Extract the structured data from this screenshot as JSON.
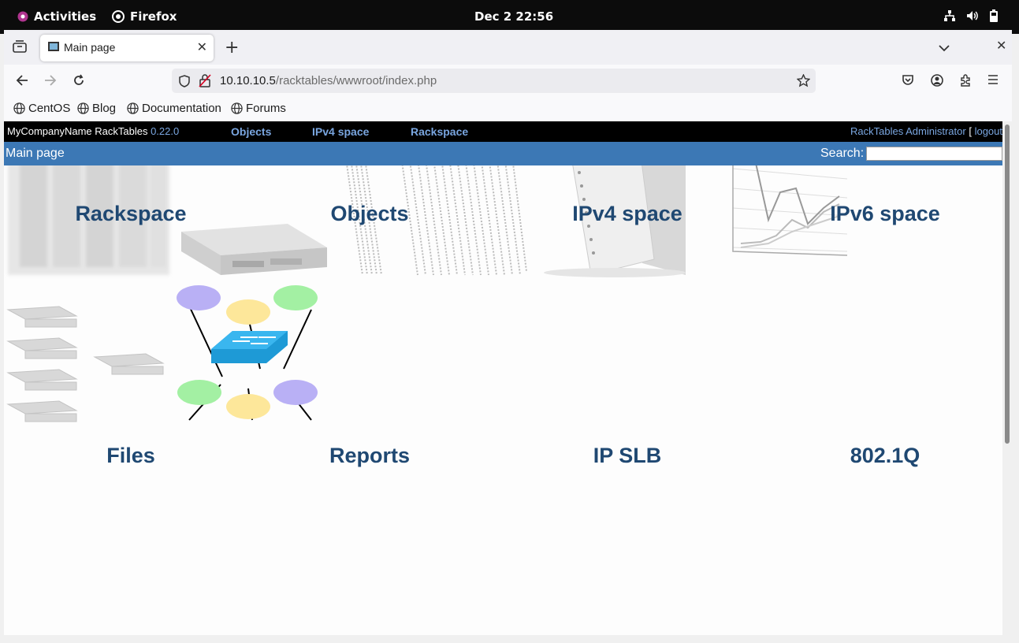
{
  "system": {
    "activities": "Activities",
    "app": "Firefox",
    "clock": "Dec 2  22:56"
  },
  "browser": {
    "tab_title": "Main page",
    "url_host": "10.10.10.5",
    "url_path": "/racktables/wwwroot/index.php",
    "bookmarks": [
      "CentOS",
      "Blog",
      "Documentation",
      "Forums"
    ]
  },
  "racktables": {
    "brand": "MyCompanyName RackTables",
    "version": "0.22.0",
    "nav": [
      "Objects",
      "IPv4 space",
      "Rackspace"
    ],
    "user": "RackTables Administrator",
    "logout": "logout",
    "user_open": "[",
    "page_title": "Main page",
    "search_label": "Search:",
    "tiles": [
      "Rackspace",
      "Objects",
      "IPv4 space",
      "IPv6 space",
      "Files",
      "Reports",
      "IP SLB",
      "802.1Q"
    ]
  },
  "icons": [
    "gnome-logo-icon",
    "firefox-icon",
    "network-icon",
    "volume-icon",
    "battery-icon",
    "tab-overview-icon",
    "new-tab-icon",
    "list-tabs-icon",
    "close-window-icon",
    "back-icon",
    "forward-icon",
    "reload-icon",
    "shield-icon",
    "insecure-lock-icon",
    "star-icon",
    "pocket-icon",
    "account-icon",
    "extensions-icon",
    "menu-icon",
    "globe-icon"
  ]
}
